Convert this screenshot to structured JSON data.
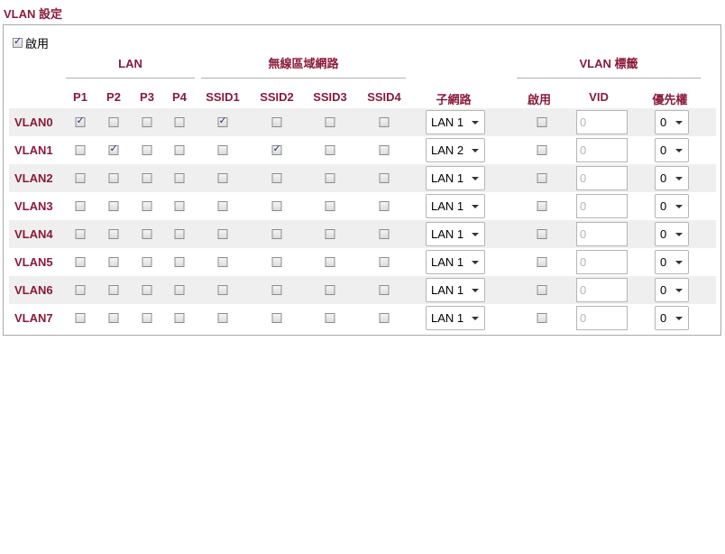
{
  "page": {
    "title": "VLAN 設定"
  },
  "enable": {
    "label": "啟用",
    "checked": true
  },
  "groups": {
    "lan": "LAN",
    "wireless": "無線區域網路",
    "vlan_tag": "VLAN 標籤"
  },
  "columns": {
    "p1": "P1",
    "p2": "P2",
    "p3": "P3",
    "p4": "P4",
    "ssid1": "SSID1",
    "ssid2": "SSID2",
    "ssid3": "SSID3",
    "ssid4": "SSID4",
    "subnet": "子網路",
    "tag_enable": "啟用",
    "vid": "VID",
    "priority": "優先權"
  },
  "rows": [
    {
      "name": "VLAN0",
      "p1": true,
      "p2": false,
      "p3": false,
      "p4": false,
      "ssid1": true,
      "ssid2": false,
      "ssid3": false,
      "ssid4": false,
      "subnet": "LAN 1",
      "tag": false,
      "vid": "0",
      "priority": "0"
    },
    {
      "name": "VLAN1",
      "p1": false,
      "p2": true,
      "p3": false,
      "p4": false,
      "ssid1": false,
      "ssid2": true,
      "ssid3": false,
      "ssid4": false,
      "subnet": "LAN 2",
      "tag": false,
      "vid": "0",
      "priority": "0"
    },
    {
      "name": "VLAN2",
      "p1": false,
      "p2": false,
      "p3": false,
      "p4": false,
      "ssid1": false,
      "ssid2": false,
      "ssid3": false,
      "ssid4": false,
      "subnet": "LAN 1",
      "tag": false,
      "vid": "0",
      "priority": "0"
    },
    {
      "name": "VLAN3",
      "p1": false,
      "p2": false,
      "p3": false,
      "p4": false,
      "ssid1": false,
      "ssid2": false,
      "ssid3": false,
      "ssid4": false,
      "subnet": "LAN 1",
      "tag": false,
      "vid": "0",
      "priority": "0"
    },
    {
      "name": "VLAN4",
      "p1": false,
      "p2": false,
      "p3": false,
      "p4": false,
      "ssid1": false,
      "ssid2": false,
      "ssid3": false,
      "ssid4": false,
      "subnet": "LAN 1",
      "tag": false,
      "vid": "0",
      "priority": "0"
    },
    {
      "name": "VLAN5",
      "p1": false,
      "p2": false,
      "p3": false,
      "p4": false,
      "ssid1": false,
      "ssid2": false,
      "ssid3": false,
      "ssid4": false,
      "subnet": "LAN 1",
      "tag": false,
      "vid": "0",
      "priority": "0"
    },
    {
      "name": "VLAN6",
      "p1": false,
      "p2": false,
      "p3": false,
      "p4": false,
      "ssid1": false,
      "ssid2": false,
      "ssid3": false,
      "ssid4": false,
      "subnet": "LAN 1",
      "tag": false,
      "vid": "0",
      "priority": "0"
    },
    {
      "name": "VLAN7",
      "p1": false,
      "p2": false,
      "p3": false,
      "p4": false,
      "ssid1": false,
      "ssid2": false,
      "ssid3": false,
      "ssid4": false,
      "subnet": "LAN 1",
      "tag": false,
      "vid": "0",
      "priority": "0"
    }
  ],
  "colors": {
    "heading": "#8b1a3a",
    "row_shade": "#efefef"
  }
}
